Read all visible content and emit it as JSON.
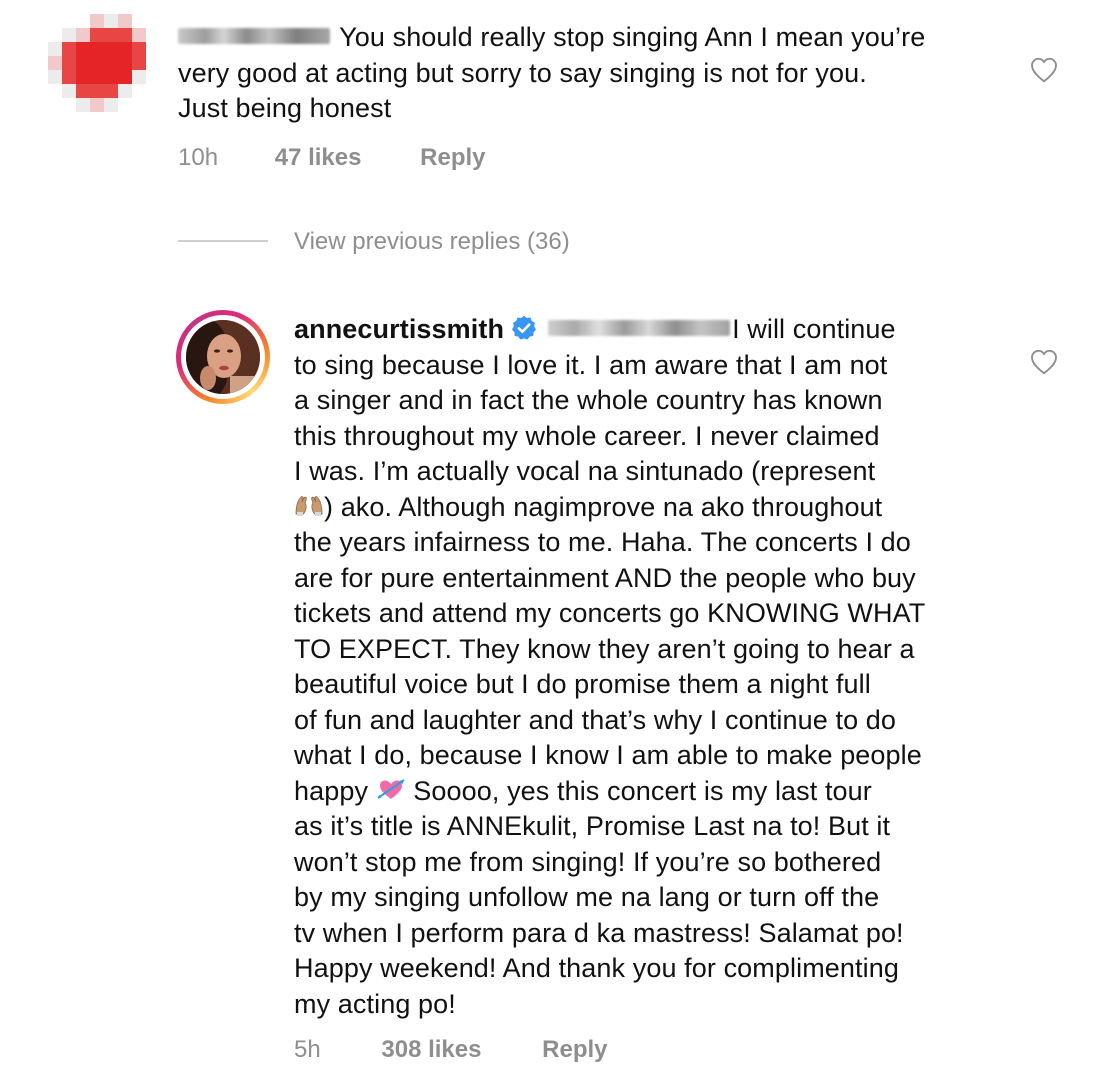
{
  "comment1": {
    "avatar_color": "#e52525",
    "lines": [
      "You should really stop singing Ann I mean you’re",
      "very good at acting but sorry to say singing is not for you.",
      "Just being honest"
    ],
    "time": "10h",
    "likes": "47 likes",
    "reply": "Reply",
    "like_icon": "heart-outline-icon"
  },
  "view_previous_replies": "View previous replies (36)",
  "comment2": {
    "username": "annecurtissmith",
    "verified_icon": "verified-badge-icon",
    "verified_color": "#3897f0",
    "first_line_text": "I will continue",
    "lines": [
      "to sing because I love it. I am aware that I am not",
      "a singer and in fact the whole country has known",
      "this throughout my whole career. I never claimed",
      "I was. I’m actually vocal na sintunado (represent"
    ],
    "line6_text": ") ako. Although nagimprove na ako throughout",
    "line6_emoji": "raising-hands-emoji",
    "lines_after": [
      "the years infairness to me. Haha. The concerts I do",
      "are for pure entertainment AND the people who buy",
      "tickets and attend my concerts go KNOWING WHAT",
      "TO EXPECT. They know they aren’t going to hear a",
      "beautiful voice but I do promise them a night full",
      "of fun and laughter and that’s why I continue to do",
      "what I do, because I know I am able to make people"
    ],
    "line14_start": "happy",
    "line14_emoji": "heart-with-arrow-emoji",
    "line14_end": "Soooo, yes this concert is my last tour",
    "lines_end": [
      "as it’s title is ANNEkulit, Promise Last na to!  But it",
      "won’t stop me from singing! If you’re so bothered",
      "by my singing unfollow me na lang or turn off the",
      "tv when I perform para d ka mastress!  Salamat po!",
      "Happy weekend! And thank you for complimenting",
      "my acting po!"
    ],
    "time": "5h",
    "likes": "308 likes",
    "reply": "Reply",
    "like_icon": "heart-outline-icon"
  }
}
